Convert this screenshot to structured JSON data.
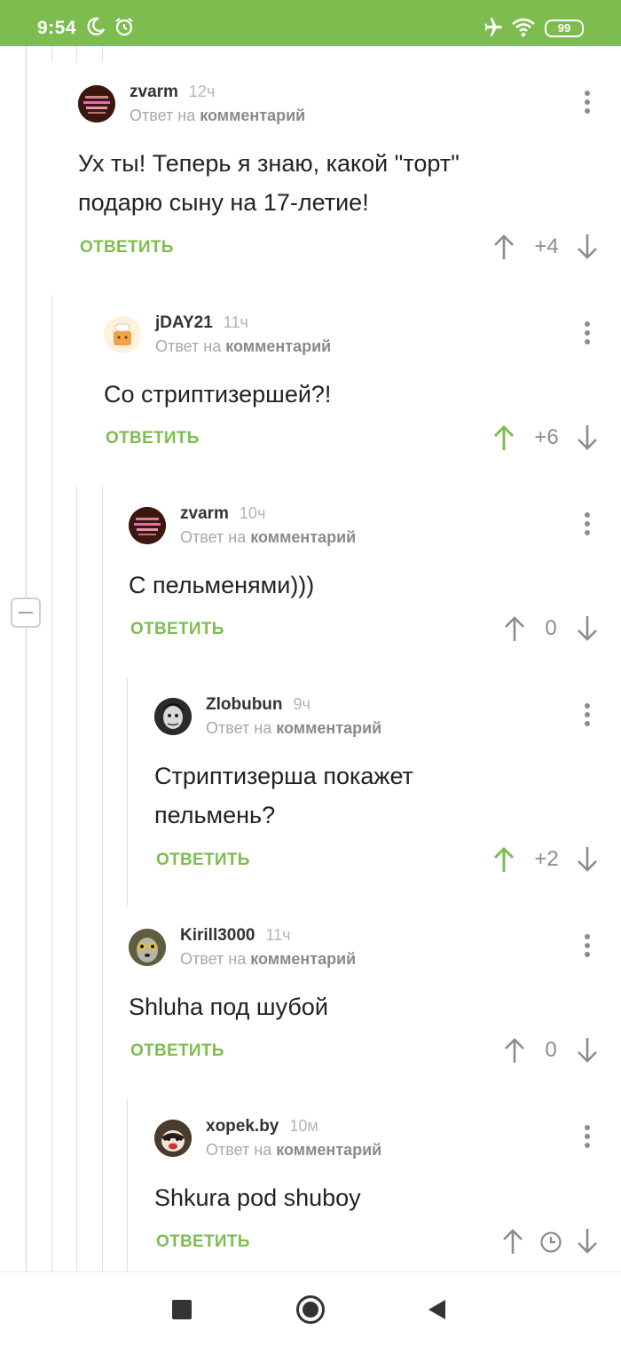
{
  "status_bar": {
    "time": "9:54",
    "battery": "99"
  },
  "comments": [
    {
      "author": "zvarm",
      "age": "12ч",
      "reply_prefix": "Ответ на",
      "reply_target": "комментарий",
      "text_lines": [
        "Ух ты! Теперь я знаю, какой \"торт\"",
        "подарю сыну на 17-летие!"
      ],
      "reply_label": "ОТВЕТИТЬ",
      "score": "+4",
      "upvoted": false
    },
    {
      "author": "jDAY21",
      "age": "11ч",
      "reply_prefix": "Ответ на",
      "reply_target": "комментарий",
      "text_lines": [
        "Со стриптизершей?!"
      ],
      "reply_label": "ОТВЕТИТЬ",
      "score": "+6",
      "upvoted": true
    },
    {
      "author": "zvarm",
      "age": "10ч",
      "reply_prefix": "Ответ на",
      "reply_target": "комментарий",
      "text_lines": [
        "С пельменями)))"
      ],
      "reply_label": "ОТВЕТИТЬ",
      "score": "0",
      "upvoted": false
    },
    {
      "author": "Zlobubun",
      "age": "9ч",
      "reply_prefix": "Ответ на",
      "reply_target": "комментарий",
      "text_lines": [
        "Стриптизерша покажет",
        "пельмень?"
      ],
      "reply_label": "ОТВЕТИТЬ",
      "score": "+2",
      "upvoted": true
    },
    {
      "author": "Kirill3000",
      "age": "11ч",
      "reply_prefix": "Ответ на",
      "reply_target": "комментарий",
      "text_lines": [
        "Shluha под шубой"
      ],
      "reply_label": "ОТВЕТИТЬ",
      "score": "0",
      "upvoted": false
    },
    {
      "author": "xopek.by",
      "age": "10м",
      "reply_prefix": "Ответ на",
      "reply_target": "комментарий",
      "text_lines": [
        "Shkura pod shuboy"
      ],
      "reply_label": "ОТВЕТИТЬ",
      "score": "",
      "score_icon": "clock-icon",
      "upvoted": false
    }
  ],
  "colors": {
    "accent": "#7dbd4f",
    "muted": "#8c8c8c",
    "status_bar": "#7dbd4f"
  },
  "nav": {
    "icons": [
      "recent-apps-icon",
      "home-icon",
      "back-icon"
    ]
  }
}
